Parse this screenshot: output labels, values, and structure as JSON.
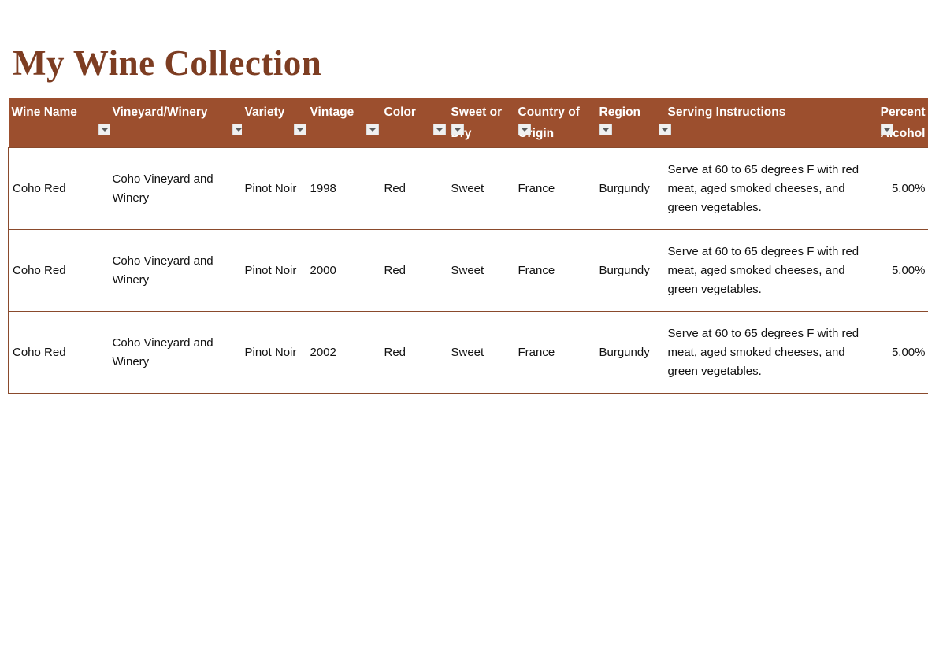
{
  "page": {
    "title": "My Wine Collection",
    "title_color": "#7d3d22",
    "background": "#ffffff"
  },
  "table": {
    "header_background": "#9c4f2e",
    "header_text_color": "#ffffff",
    "border_color": "#8a4a2c",
    "filter_icon": "chevron-down-icon",
    "columns": [
      {
        "label": "Wine Name",
        "has_filter": true,
        "align": "left"
      },
      {
        "label": "Vineyard/Winery",
        "has_filter": true,
        "align": "left"
      },
      {
        "label": "Variety",
        "has_filter": true,
        "align": "left"
      },
      {
        "label": "Vintage",
        "has_filter": true,
        "align": "left"
      },
      {
        "label": "Color",
        "has_filter": true,
        "align": "left"
      },
      {
        "label": "Sweet or Dry",
        "has_filter": true,
        "align": "left"
      },
      {
        "label": "Country of Origin",
        "has_filter": true,
        "align": "left"
      },
      {
        "label": "Region",
        "has_filter": true,
        "align": "left"
      },
      {
        "label": "Serving Instructions",
        "has_filter": true,
        "align": "left"
      },
      {
        "label": "Percent Alcohol",
        "has_filter": true,
        "align": "right"
      }
    ],
    "rows": [
      {
        "wine_name": "Coho Red",
        "vineyard": "Coho Vineyard and Winery",
        "variety": "Pinot Noir",
        "vintage": "1998",
        "color": "Red",
        "sweet_or_dry": "Sweet",
        "country": "France",
        "region": "Burgundy",
        "serving": "Serve at 60 to 65 degrees F with red meat, aged smoked cheeses, and green vegetables.",
        "alcohol": "5.00%"
      },
      {
        "wine_name": "Coho Red",
        "vineyard": "Coho Vineyard and Winery",
        "variety": "Pinot Noir",
        "vintage": "2000",
        "color": "Red",
        "sweet_or_dry": "Sweet",
        "country": "France",
        "region": "Burgundy",
        "serving": "Serve at 60 to 65 degrees F with red meat, aged smoked cheeses, and green vegetables.",
        "alcohol": "5.00%"
      },
      {
        "wine_name": "Coho Red",
        "vineyard": "Coho Vineyard and Winery",
        "variety": "Pinot Noir",
        "vintage": "2002",
        "color": "Red",
        "sweet_or_dry": "Sweet",
        "country": "France",
        "region": "Burgundy",
        "serving": "Serve at 60 to 65 degrees F with red meat, aged smoked cheeses, and green vegetables.",
        "alcohol": "5.00%"
      }
    ]
  }
}
